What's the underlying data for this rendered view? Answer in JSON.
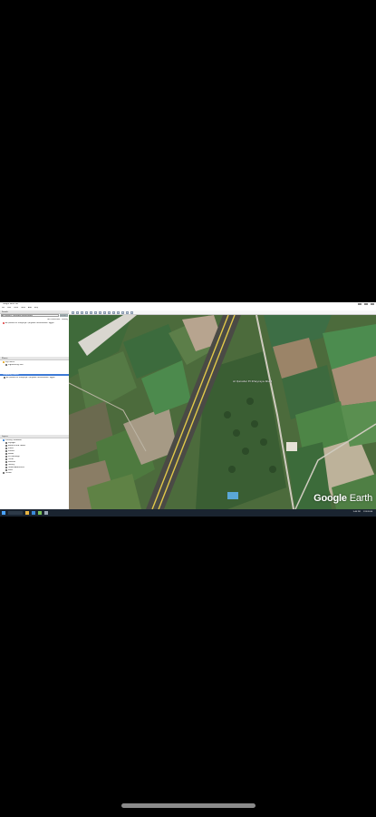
{
  "window": {
    "title": "Google Earth Pro"
  },
  "menu": [
    "File",
    "Edit",
    "View",
    "Tools",
    "Add",
    "Help"
  ],
  "search": {
    "header": "Search",
    "value": "Al Qanater, Qalyubia Governorate",
    "button": "Search",
    "links": [
      "Get Directions",
      "History"
    ],
    "result": "Al Qanater El Khayreya, Qalyubia Governorate, Egypt"
  },
  "places": {
    "header": "Places",
    "items": [
      "My Places",
      "Sightseeing Tour",
      "Temporary Places"
    ],
    "selected": "Temporary Places"
  },
  "layers": {
    "header": "Layers",
    "items": [
      "Primary Database",
      "Voyager",
      "Borders and Labels",
      "Places",
      "Photos",
      "Roads",
      "3D Buildings",
      "Ocean",
      "Weather",
      "Gallery",
      "Global Awareness",
      "More",
      "Terrain"
    ]
  },
  "map": {
    "label": "Al Qanater El Khayreya Road",
    "logo_bold": "Google",
    "logo_light": "Earth"
  },
  "taskbar": {
    "time": "3:45 PM",
    "date": "1/15/2024"
  }
}
